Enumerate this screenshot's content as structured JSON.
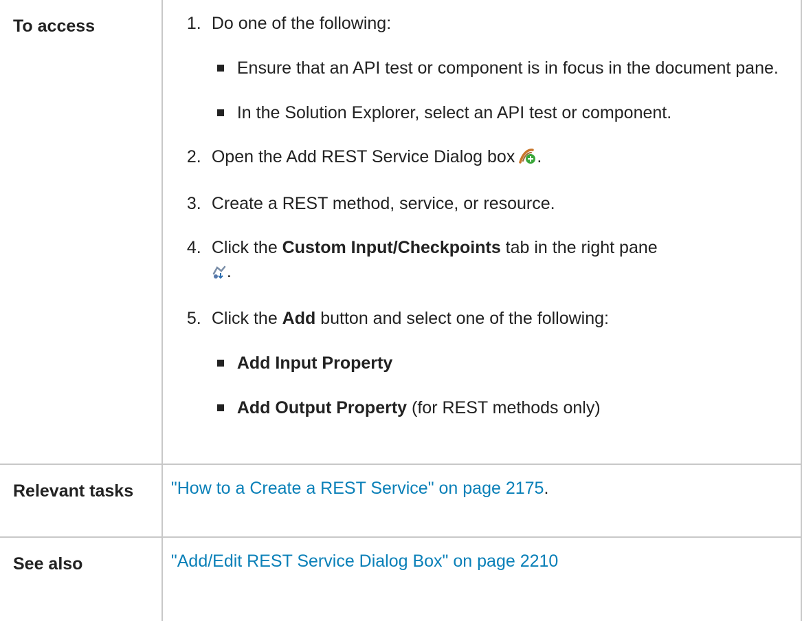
{
  "rows": [
    {
      "label": "To access",
      "steps": [
        {
          "num": "1.",
          "text": "Do one of the following:",
          "sub": [
            "Ensure that an API test or component is in focus in the document pane.",
            "In the Solution Explorer, select an API test or component."
          ]
        },
        {
          "num": "2.",
          "text": "Open the Add REST Service Dialog box",
          "icon": "add-rest-service-icon",
          "after": "."
        },
        {
          "num": "3.",
          "text": "Create a REST method, service, or resource."
        },
        {
          "num": "4.",
          "pre": "Click the ",
          "bold": "Custom Input/Checkpoints",
          "post": " tab in the right pane",
          "icon": "custom-checkpoints-icon",
          "after": "."
        },
        {
          "num": "5.",
          "pre": "Click the ",
          "bold": "Add",
          "post": " button and select one of the following:",
          "sub": [
            {
              "bold": "Add Input Property",
              "rest": ""
            },
            {
              "bold": "Add Output Property",
              "rest": " (for REST methods only)"
            }
          ]
        }
      ]
    },
    {
      "label": "Relevant tasks",
      "link": "\"How to a Create a REST Service\" on page 2175",
      "after": "."
    },
    {
      "label": "See also",
      "link": "\"Add/Edit REST Service Dialog Box\" on page 2210"
    }
  ],
  "colors": {
    "link": "#0a80b8",
    "border": "#c8c8c8",
    "text": "#222222"
  }
}
